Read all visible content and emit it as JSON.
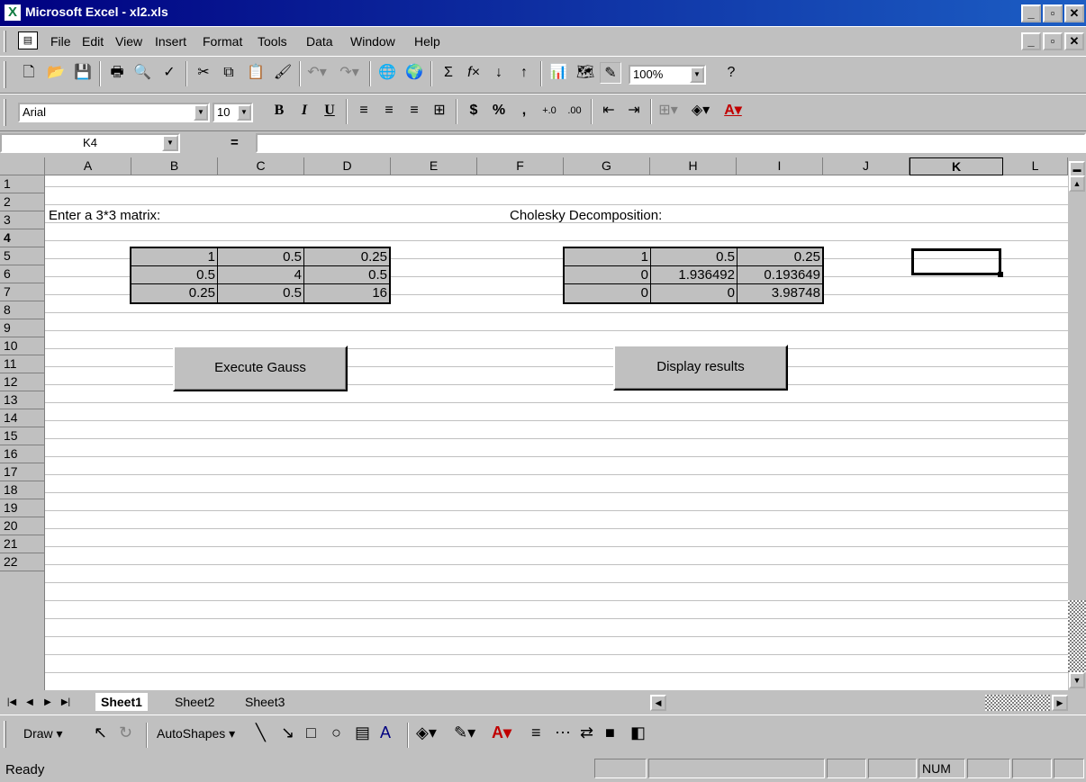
{
  "window": {
    "title": "Microsoft Excel - xl2.xls"
  },
  "menu": [
    "File",
    "Edit",
    "View",
    "Insert",
    "Format",
    "Tools",
    "Data",
    "Window",
    "Help"
  ],
  "formatting": {
    "font": "Arial",
    "size": "10",
    "zoom": "100%"
  },
  "formula_bar": {
    "name_box": "K4",
    "equals": "=",
    "formula": ""
  },
  "columns": [
    "A",
    "B",
    "C",
    "D",
    "E",
    "F",
    "G",
    "H",
    "I",
    "J",
    "K",
    "L"
  ],
  "rows": [
    "1",
    "2",
    "3",
    "4",
    "5",
    "6",
    "7",
    "8",
    "9",
    "10",
    "11",
    "12",
    "13",
    "14",
    "15",
    "16",
    "17",
    "18",
    "19",
    "20",
    "21",
    "22"
  ],
  "sheet": {
    "input_label": "Enter a 3*3 matrix:",
    "output_label": "Cholesky Decomposition:",
    "input_matrix": [
      [
        "1",
        "0.5",
        "0.25"
      ],
      [
        "0.5",
        "4",
        "0.5"
      ],
      [
        "0.25",
        "0.5",
        "16"
      ]
    ],
    "output_matrix": [
      [
        "1",
        "0.5",
        "0.25"
      ],
      [
        "0",
        "1.936492",
        "0.193649"
      ],
      [
        "0",
        "0",
        "3.98748"
      ]
    ],
    "execute_button": "Execute Gauss",
    "display_button": "Display results"
  },
  "tabs": [
    "Sheet1",
    "Sheet2",
    "Sheet3"
  ],
  "draw_toolbar": {
    "draw": "Draw ▾",
    "autoshapes": "AutoShapes ▾"
  },
  "status": {
    "text": "Ready",
    "num": "NUM"
  }
}
